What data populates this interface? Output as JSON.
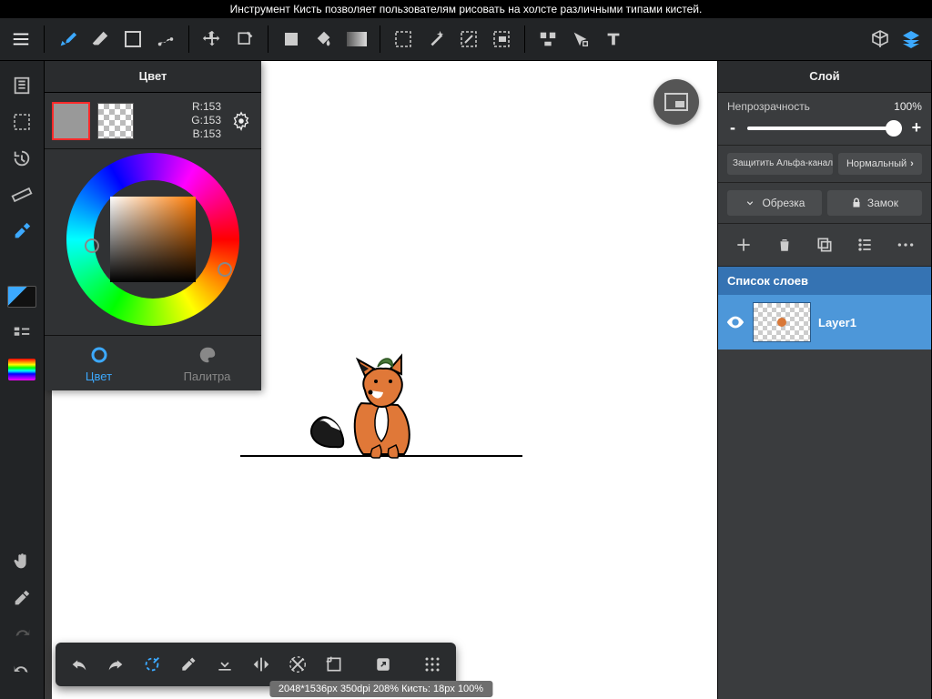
{
  "hint": "Инструмент Кисть позволяет пользователям рисовать на холсте различными типами кистей.",
  "color_panel": {
    "title": "Цвет",
    "r": "R:153",
    "g": "G:153",
    "b": "B:153",
    "tab_color": "Цвет",
    "tab_palette": "Палитра"
  },
  "layer_panel": {
    "title": "Слой",
    "opacity_label": "Непрозрачность",
    "opacity_value": "100%",
    "protect_alpha": "Защитить Альфа-канал",
    "blend_mode": "Нормальный",
    "crop": "Обрезка",
    "lock": "Замок",
    "list_header": "Список слоев",
    "layer1": "Layer1"
  },
  "status": "2048*1536px 350dpi 208% Кисть: 18px 100%"
}
